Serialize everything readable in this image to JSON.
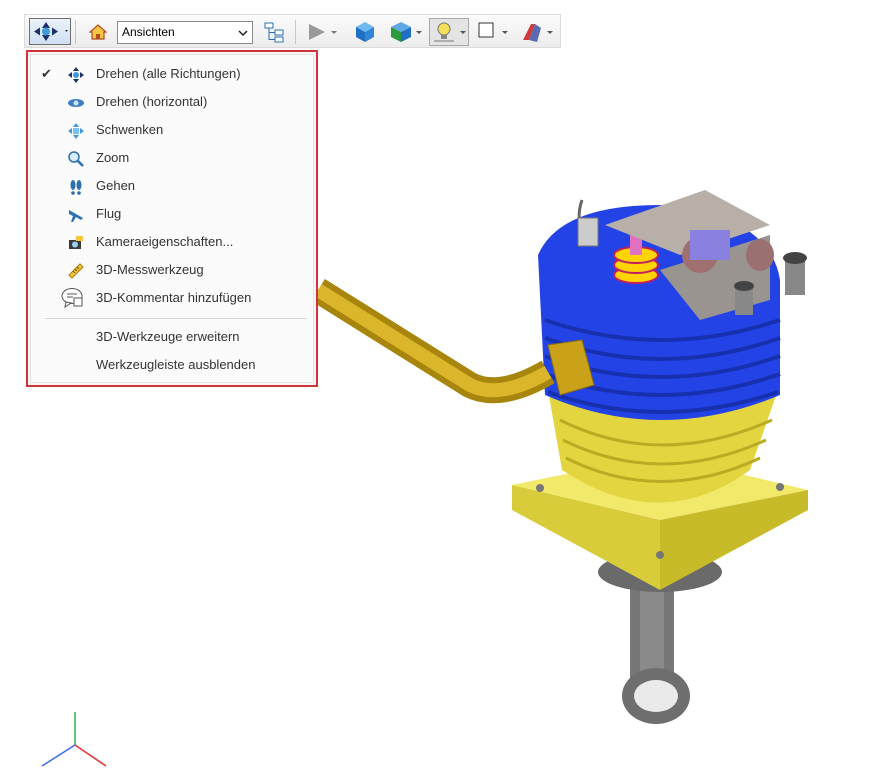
{
  "toolbar": {
    "views_value": "Ansichten",
    "icons": [
      "rotate-tool-icon",
      "home-icon",
      "model-tree-icon",
      "play-icon",
      "cube-icon",
      "cube-color-icon",
      "lighting-icon",
      "background-icon",
      "cross-section-icon"
    ]
  },
  "menu": {
    "items": [
      {
        "label": "Drehen (alle Richtungen)",
        "checked": true,
        "icon": "rotate-all-icon"
      },
      {
        "label": "Drehen (horizontal)",
        "checked": false,
        "icon": "rotate-horizontal-icon"
      },
      {
        "label": "Schwenken",
        "checked": false,
        "icon": "pan-icon"
      },
      {
        "label": "Zoom",
        "checked": false,
        "icon": "zoom-icon"
      },
      {
        "label": "Gehen",
        "checked": false,
        "icon": "walk-icon"
      },
      {
        "label": "Flug",
        "checked": false,
        "icon": "fly-icon"
      },
      {
        "label": "Kameraeigenschaften...",
        "checked": false,
        "icon": "camera-icon"
      },
      {
        "label": "3D-Messwerkzeug",
        "checked": false,
        "icon": "measure-icon"
      },
      {
        "label": "3D-Kommentar hinzufügen",
        "checked": false,
        "icon": "comment-icon"
      }
    ],
    "extra": [
      {
        "label": "3D-Werkzeuge erweitern"
      },
      {
        "label": "Werkzeugleiste ausblenden"
      }
    ],
    "check_glyph": "✔"
  },
  "colors": {
    "menu_border": "#d0333a",
    "cylinder": "#1f3fe0",
    "base": "#e6d84a",
    "pipe": "#c9a21a",
    "rocker": "#9a9a9a"
  }
}
